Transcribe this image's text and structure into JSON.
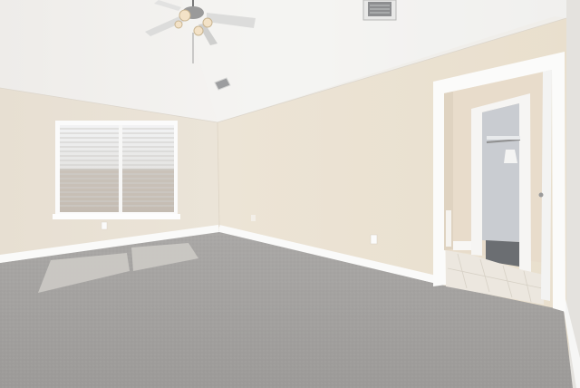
{
  "scene": {
    "kind": "empty-bedroom-photo",
    "elements": [
      "vaulted-ceiling",
      "ceiling-fan",
      "air-vent",
      "window-with-blinds",
      "carpet-floor",
      "open-doorway",
      "bathroom",
      "walk-in-closet"
    ]
  },
  "colors": {
    "ceiling": "#f1efec",
    "wall_left": "#e9e2d6",
    "wall_back": "#ebe2d2",
    "wall_right": "#e7e4df",
    "trim": "#fbfbfa",
    "carpet": "#a4a2a0",
    "window_glass": "#e6e9ec",
    "blind_slat": "#d9d7d4",
    "closet_interior": "#c9ccd1",
    "bath_tile": "#ece8e1"
  }
}
